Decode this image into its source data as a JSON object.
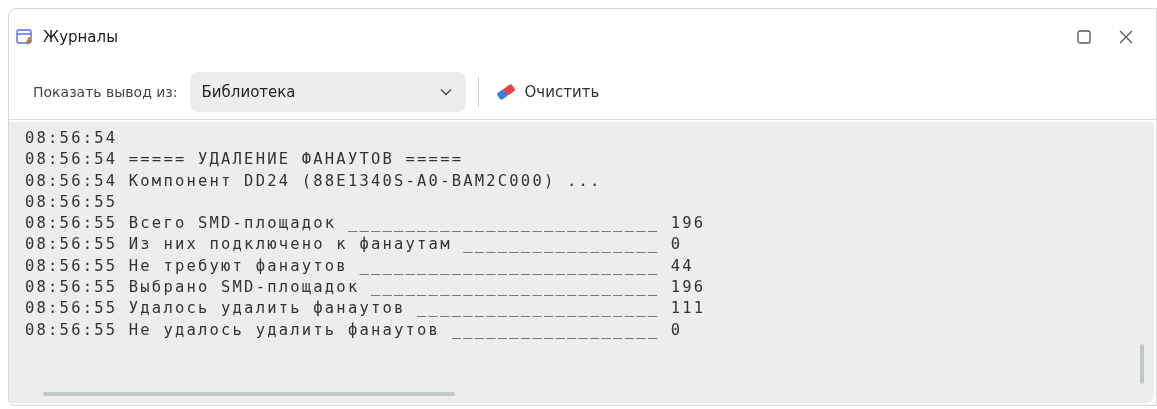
{
  "window": {
    "title": "Журналы"
  },
  "toolbar": {
    "source_label": "Показать вывод из:",
    "source_value": "Библиотека",
    "clear_button": "Очистить"
  },
  "log_lines": [
    "08:56:54",
    "08:56:54 ===== УДАЛЕНИЕ ФАНАУТОВ =====",
    "08:56:54 Компонент DD24 (88E1340S-A0-BAM2C000) ...",
    "08:56:55",
    "08:56:55 Всего SMD-площадок ___________________________ 196",
    "08:56:55 Из них подключено к фанаутам _________________ 0",
    "08:56:55 Не требуют фанаутов __________________________ 44",
    "08:56:55 Выбрано SMD-площадок _________________________ 196",
    "08:56:55 Удалось удалить фанаутов _____________________ 111",
    "08:56:55 Не удалось удалить фанаутов __________________ 0"
  ]
}
